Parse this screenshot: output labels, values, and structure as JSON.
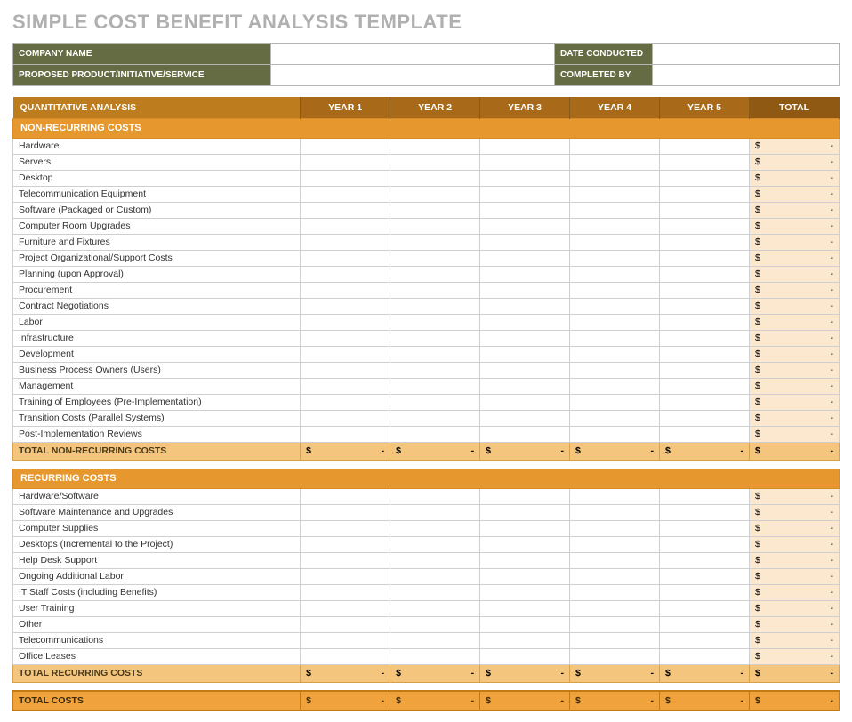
{
  "title": "SIMPLE COST BENEFIT ANALYSIS TEMPLATE",
  "meta": {
    "companyNameLabel": "COMPANY NAME",
    "proposedLabel": "PROPOSED PRODUCT/INITIATIVE/SERVICE",
    "dateConductedLabel": "DATE CONDUCTED",
    "completedByLabel": "COMPLETED BY",
    "companyName": "",
    "proposed": "",
    "dateConducted": "",
    "completedBy": ""
  },
  "headers": {
    "section": "QUANTITATIVE ANALYSIS",
    "years": [
      "YEAR 1",
      "YEAR 2",
      "YEAR 3",
      "YEAR 4",
      "YEAR 5"
    ],
    "total": "TOTAL"
  },
  "currencySymbol": "$",
  "dash": "-",
  "sections": [
    {
      "title": "NON-RECURRING COSTS",
      "rows": [
        "Hardware",
        "Servers",
        "Desktop",
        "Telecommunication Equipment",
        "Software (Packaged or Custom)",
        "Computer Room Upgrades",
        "Furniture and Fixtures",
        "Project Organizational/Support Costs",
        "Planning (upon Approval)",
        "Procurement",
        "Contract Negotiations",
        "Labor",
        "Infrastructure",
        "Development",
        "Business Process Owners (Users)",
        "Management",
        "Training of Employees (Pre-Implementation)",
        "Transition Costs (Parallel Systems)",
        "Post-Implementation Reviews"
      ],
      "subtotalLabel": "TOTAL NON-RECURRING COSTS"
    },
    {
      "title": "RECURRING COSTS",
      "rows": [
        "Hardware/Software",
        "Software Maintenance and Upgrades",
        "Computer Supplies",
        "Desktops (Incremental to the Project)",
        "Help Desk Support",
        "Ongoing Additional Labor",
        "IT Staff Costs (including Benefits)",
        "User Training",
        "Other",
        "Telecommunications",
        "Office Leases"
      ],
      "subtotalLabel": "TOTAL RECURRING COSTS"
    }
  ],
  "grandTotalLabel": "TOTAL COSTS"
}
